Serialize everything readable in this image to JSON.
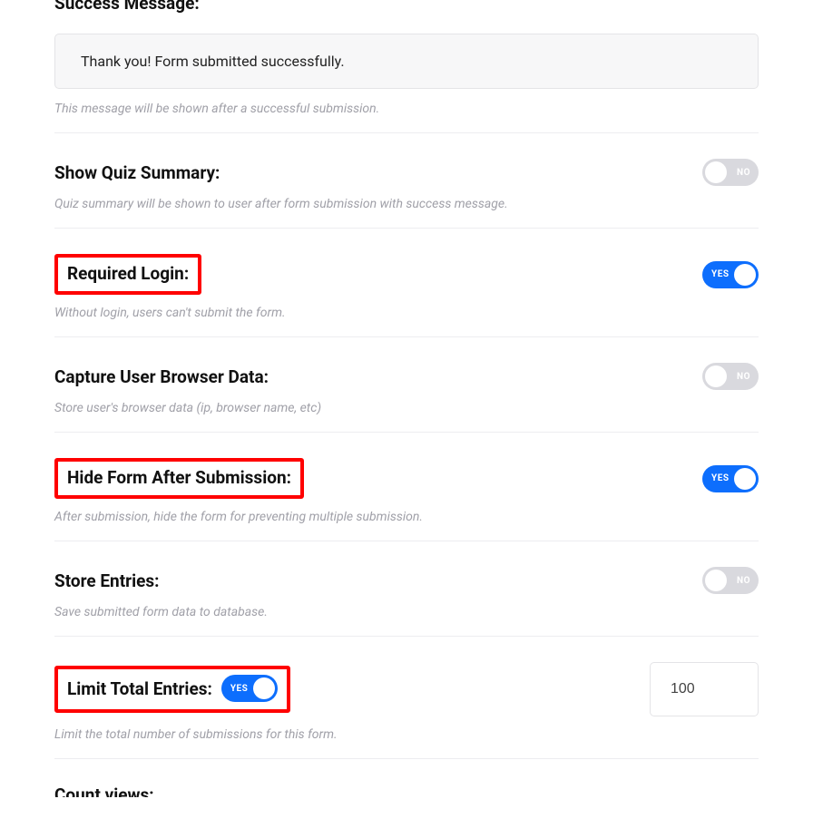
{
  "successMessage": {
    "title": "Success Message:",
    "value": "Thank you! Form submitted successfully.",
    "help": "This message will be shown after a successful submission."
  },
  "quizSummary": {
    "label": "Show Quiz Summary:",
    "help": "Quiz summary will be shown to user after form submission with success message.",
    "toggle": {
      "state": "off",
      "text": "NO"
    }
  },
  "requiredLogin": {
    "label": "Required Login:",
    "help": "Without login, users can't submit the form.",
    "toggle": {
      "state": "on",
      "text": "YES"
    }
  },
  "captureBrowser": {
    "label": "Capture User Browser Data:",
    "help": "Store user's browser data (ip, browser name, etc)",
    "toggle": {
      "state": "off",
      "text": "NO"
    }
  },
  "hideForm": {
    "label": "Hide Form After Submission:",
    "help": "After submission, hide the form for preventing multiple submission.",
    "toggle": {
      "state": "on",
      "text": "YES"
    }
  },
  "storeEntries": {
    "label": "Store Entries:",
    "help": "Save submitted form data to database.",
    "toggle": {
      "state": "off",
      "text": "NO"
    }
  },
  "limitEntries": {
    "label": "Limit Total Entries:",
    "help": "Limit the total number of submissions for this form.",
    "toggle": {
      "state": "on",
      "text": "YES"
    },
    "value": "100"
  },
  "countViews": {
    "label": "Count views:"
  }
}
